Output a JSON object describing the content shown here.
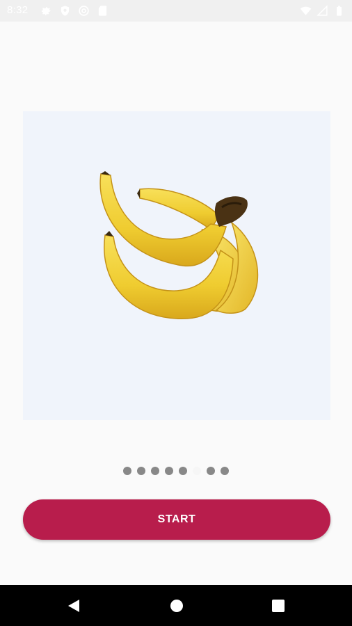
{
  "status_bar": {
    "time": "8:32",
    "left_icons": [
      "settings-icon",
      "shield-icon",
      "at-sign-icon",
      "sd-card-icon"
    ],
    "right_icons": [
      "wifi-icon",
      "signal-icon",
      "battery-icon"
    ]
  },
  "onboarding": {
    "image": "banana-bunch",
    "page_count": 8,
    "current_page": 6
  },
  "start_button": {
    "label": "START"
  },
  "nav_bar": {
    "buttons": [
      "back-icon",
      "home-icon",
      "recents-icon"
    ]
  },
  "colors": {
    "accent": "#b81d4c",
    "panel": "#f0f4fb",
    "dot_inactive": "#888888",
    "dot_active": "#f6f6f6"
  }
}
